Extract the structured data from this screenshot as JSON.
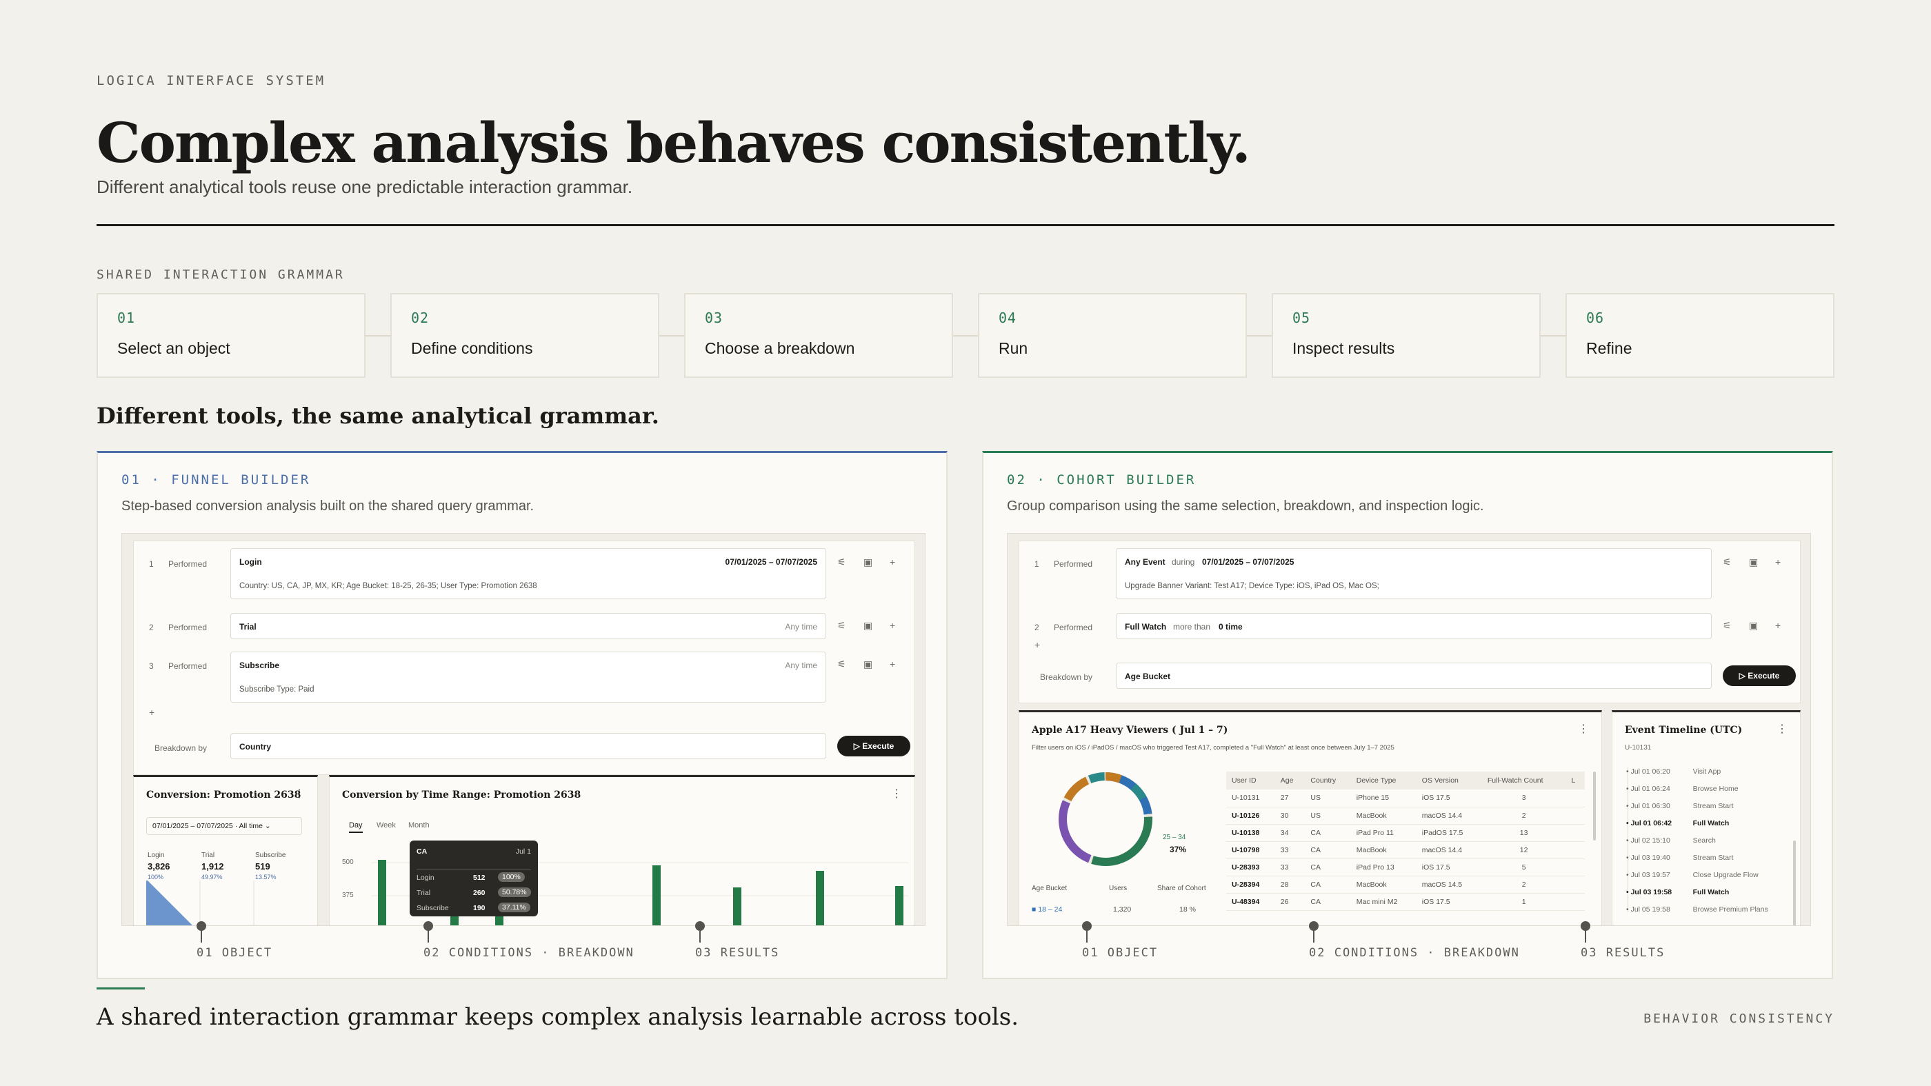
{
  "header": {
    "kicker": "LOGICA INTERFACE SYSTEM",
    "title": "Complex analysis behaves consistently.",
    "subtitle": "Different analytical tools reuse one predictable interaction grammar."
  },
  "grammar": {
    "label": "SHARED INTERACTION GRAMMAR",
    "steps": [
      {
        "num": "01",
        "label": "Select an object"
      },
      {
        "num": "02",
        "label": "Define conditions"
      },
      {
        "num": "03",
        "label": "Choose a breakdown"
      },
      {
        "num": "04",
        "label": "Run"
      },
      {
        "num": "05",
        "label": "Inspect results"
      },
      {
        "num": "06",
        "label": "Refine"
      }
    ]
  },
  "section_title": "Different tools, the same analytical grammar.",
  "funnel": {
    "tag": "01 · FUNNEL BUILDER",
    "desc": "Step-based conversion analysis built on the shared query grammar.",
    "rows": [
      {
        "idx": "1",
        "verb": "Performed",
        "event": "Login",
        "range": "07/01/2025 – 07/07/2025",
        "filter": "Country: US, CA, JP, MX, KR; Age Bucket: 18-25, 26-35; User Type: Promotion 2638"
      },
      {
        "idx": "2",
        "verb": "Performed",
        "event": "Trial",
        "range": "Any time"
      },
      {
        "idx": "3",
        "verb": "Performed",
        "event": "Subscribe",
        "range": "Any time",
        "filter": "Subscribe Type: Paid"
      }
    ],
    "add": "+",
    "breakdown_label": "Breakdown by",
    "breakdown_value": "Country",
    "execute": "Execute",
    "conv": {
      "title": "Conversion: Promotion 2638",
      "range": "07/01/2025 – 07/07/2025 · All time",
      "steps": [
        {
          "label": "Login",
          "value": "3,826",
          "pct": "100%"
        },
        {
          "label": "Trial",
          "value": "1,912",
          "pct": "49.97%"
        },
        {
          "label": "Subscribe",
          "value": "519",
          "pct": "13.57%"
        }
      ]
    },
    "time": {
      "title": "Conversion by Time Range: Promotion 2638",
      "tabs": [
        "Day",
        "Week",
        "Month"
      ],
      "yticks": [
        "500",
        "375"
      ],
      "tooltip": {
        "title": "CA",
        "date": "Jul 1",
        "rows": [
          {
            "label": "Login",
            "value": "512",
            "pct": "100%"
          },
          {
            "label": "Trial",
            "value": "260",
            "pct": "50.78%"
          },
          {
            "label": "Subscribe",
            "value": "190",
            "pct": "37.11%"
          }
        ]
      }
    },
    "markers": [
      "01 OBJECT",
      "02 CONDITIONS · BREAKDOWN",
      "03 RESULTS"
    ]
  },
  "cohort": {
    "tag": "02 · COHORT BUILDER",
    "desc": "Group comparison using the same selection, breakdown, and inspection logic.",
    "rows": [
      {
        "idx": "1",
        "verb": "Performed",
        "event": "Any Event",
        "mid": "during",
        "range": "07/01/2025 – 07/07/2025",
        "filter": "Upgrade Banner Variant: Test A17; Device Type: iOS, iPad OS, Mac OS;"
      },
      {
        "idx": "2",
        "verb": "Performed",
        "event": "Full Watch",
        "mid": "more than",
        "range": "0 time"
      }
    ],
    "add": "+",
    "breakdown_label": "Breakdown by",
    "breakdown_value": "Age Bucket",
    "execute": "Execute",
    "card": {
      "title": "Apple A17 Heavy Viewers ( Jul 1 – 7)",
      "desc": "Filter users on iOS / iPadOS / macOS who triggered Test A17, completed a \"Full Watch\" at least once between July 1–7 2025",
      "donut_label": "25 – 34",
      "donut_pct": "37%",
      "legend_head": [
        "Age Bucket",
        "Users",
        "Share of Cohort"
      ],
      "legend_row": [
        "18 – 24",
        "1,320",
        "18 %"
      ],
      "headers": [
        "User ID",
        "Age",
        "Country",
        "Device Type",
        "OS Version",
        "Full-Watch Count",
        "L"
      ],
      "rows": [
        [
          "U-10131",
          "27",
          "US",
          "iPhone 15",
          "iOS 17.5",
          "3"
        ],
        [
          "U-10126",
          "30",
          "US",
          "MacBook",
          "macOS 14.4",
          "2"
        ],
        [
          "U-10138",
          "34",
          "CA",
          "iPad Pro 11",
          "iPadOS 17.5",
          "13"
        ],
        [
          "U-10798",
          "33",
          "CA",
          "MacBook",
          "macOS 14.4",
          "12"
        ],
        [
          "U-28393",
          "33",
          "CA",
          "iPad Pro 13",
          "iOS 17.5",
          "5"
        ],
        [
          "U-28394",
          "28",
          "CA",
          "MacBook",
          "macOS 14.5",
          "2"
        ],
        [
          "U-48394",
          "26",
          "CA",
          "Mac mini M2",
          "iOS 17.5",
          "1"
        ]
      ]
    },
    "timeline": {
      "title": "Event Timeline (UTC)",
      "user": "U-10131",
      "events": [
        {
          "t": "Jul 01 06:20",
          "e": "Visit App"
        },
        {
          "t": "Jul 01 06:24",
          "e": "Browse Home"
        },
        {
          "t": "Jul 01 06:30",
          "e": "Stream Start"
        },
        {
          "t": "Jul 01 06:42",
          "e": "Full Watch"
        },
        {
          "t": "Jul 02 15:10",
          "e": "Search"
        },
        {
          "t": "Jul 03 19:40",
          "e": "Stream Start"
        },
        {
          "t": "Jul 03 19:57",
          "e": "Close Upgrade Flow"
        },
        {
          "t": "Jul 03 19:58",
          "e": "Full Watch"
        },
        {
          "t": "Jul 05 19:58",
          "e": "Browse Premium Plans"
        }
      ]
    },
    "markers": [
      "01 OBJECT",
      "02 CONDITIONS · BREAKDOWN",
      "03 RESULTS"
    ]
  },
  "footer": {
    "statement": "A shared interaction grammar keeps complex analysis learnable across tools.",
    "tag": "BEHAVIOR CONSISTENCY"
  },
  "colors": {
    "accent_green": "#2a7a53",
    "accent_blue": "#4b6fa8",
    "ink": "#1c1b18",
    "paper": "#f3f1eb"
  }
}
